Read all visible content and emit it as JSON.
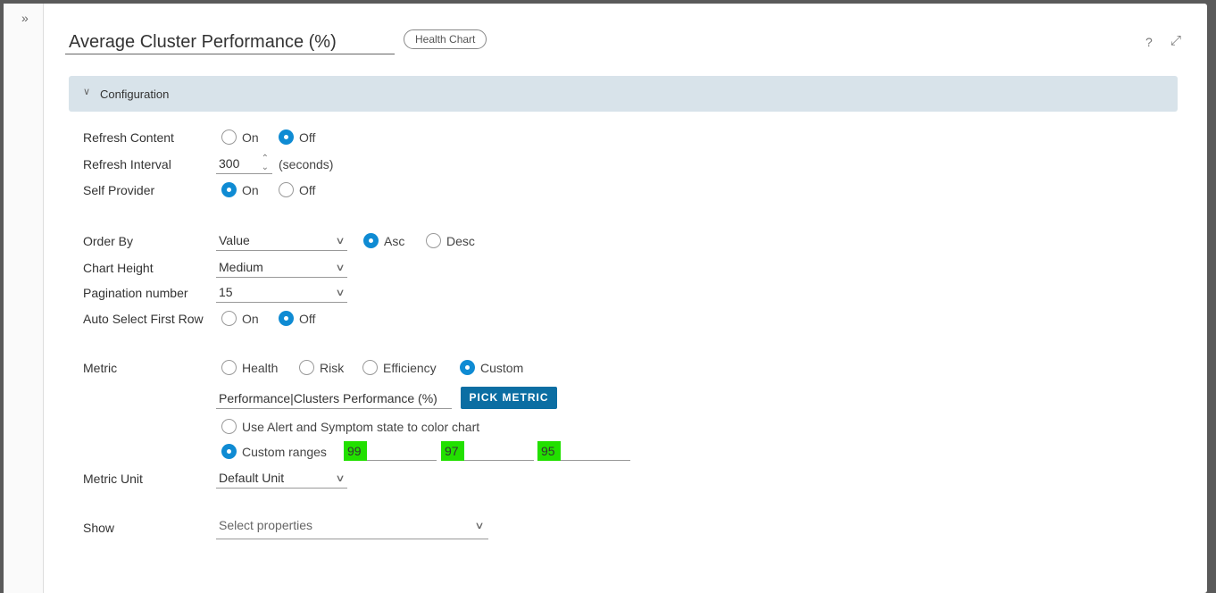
{
  "header": {
    "title": "Average Cluster Performance (%)",
    "badge": "Health Chart",
    "help": "?",
    "expand": "⤢",
    "sidebar_toggle": "»"
  },
  "config": {
    "section_label": "Configuration",
    "chevron": "∨"
  },
  "form": {
    "refresh_content": {
      "label": "Refresh Content",
      "on": "On",
      "off": "Off",
      "selected": "Off"
    },
    "refresh_interval": {
      "label": "Refresh Interval",
      "value": "300",
      "unit": "(seconds)"
    },
    "self_provider": {
      "label": "Self Provider",
      "on": "On",
      "off": "Off",
      "selected": "On"
    },
    "order_by": {
      "label": "Order By",
      "value": "Value",
      "asc": "Asc",
      "desc": "Desc",
      "selected": "Asc"
    },
    "chart_height": {
      "label": "Chart Height",
      "value": "Medium"
    },
    "pagination": {
      "label": "Pagination number",
      "value": "15"
    },
    "auto_select": {
      "label": "Auto Select First Row",
      "on": "On",
      "off": "Off",
      "selected": "Off"
    },
    "metric": {
      "label": "Metric",
      "options": [
        "Health",
        "Risk",
        "Efficiency",
        "Custom"
      ],
      "selected": "Custom",
      "value": "Performance|Clusters Performance (%)",
      "pick_button": "PICK METRIC",
      "alert_option": "Use Alert and Symptom state to color chart",
      "ranges_option": "Custom ranges",
      "ranges": [
        "99",
        "97",
        "95"
      ],
      "range_highlight": "#22e000"
    },
    "metric_unit": {
      "label": "Metric Unit",
      "value": "Default Unit"
    },
    "show": {
      "label": "Show",
      "placeholder": "Select properties"
    }
  },
  "colors": {
    "accent": "#0f8bd3",
    "button": "#0b6ea3",
    "config_bg": "#d8e3ea"
  }
}
